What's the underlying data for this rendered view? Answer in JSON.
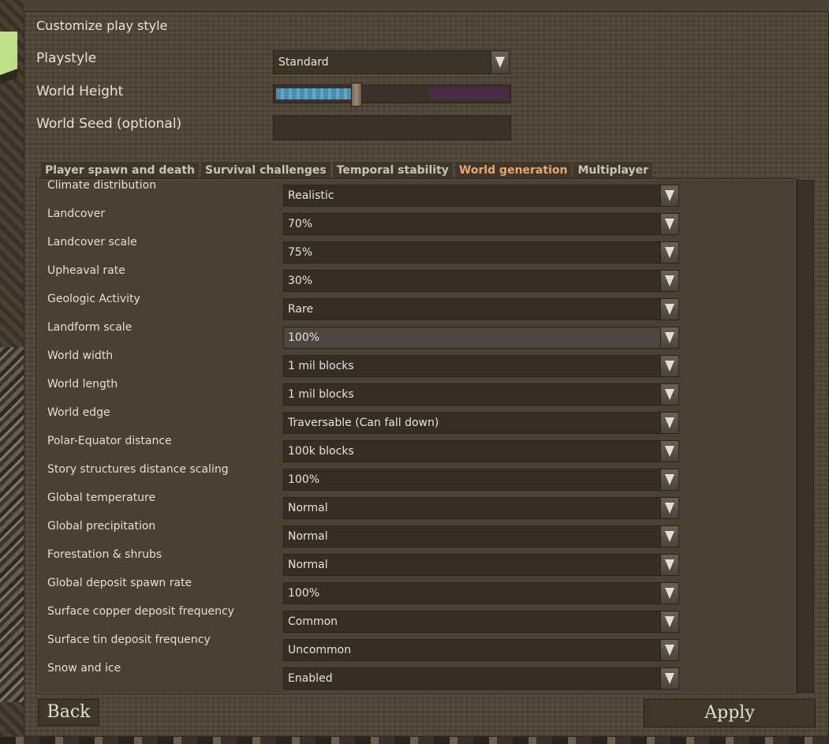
{
  "dialog": {
    "title": "Customize play style",
    "playstyle": {
      "label": "Playstyle",
      "value": "Standard"
    },
    "world_height": {
      "label": "World Height",
      "level": 0.34
    },
    "world_seed": {
      "label": "World Seed (optional)",
      "value": ""
    }
  },
  "tabs": [
    {
      "label": "Player spawn and death",
      "active": false
    },
    {
      "label": "Survival challenges",
      "active": false
    },
    {
      "label": "Temporal stability",
      "active": false
    },
    {
      "label": "World generation",
      "active": true
    },
    {
      "label": "Multiplayer",
      "active": false
    }
  ],
  "settings": [
    {
      "label": "Climate distribution",
      "value": "Realistic"
    },
    {
      "label": "Landcover",
      "value": "70%"
    },
    {
      "label": "Landcover scale",
      "value": "75%"
    },
    {
      "label": "Upheaval rate",
      "value": "30%"
    },
    {
      "label": "Geologic Activity",
      "value": "Rare"
    },
    {
      "label": "Landform scale",
      "value": "100%"
    },
    {
      "label": "World width",
      "value": "1 mil blocks"
    },
    {
      "label": "World length",
      "value": "1 mil blocks"
    },
    {
      "label": "World edge",
      "value": "Traversable (Can fall down)"
    },
    {
      "label": "Polar-Equator distance",
      "value": "100k blocks"
    },
    {
      "label": "Story structures distance scaling",
      "value": "100%"
    },
    {
      "label": "Global temperature",
      "value": "Normal"
    },
    {
      "label": "Global precipitation",
      "value": "Normal"
    },
    {
      "label": "Forestation & shrubs",
      "value": "Normal"
    },
    {
      "label": "Global deposit spawn rate",
      "value": "100%"
    },
    {
      "label": "Surface copper deposit frequency",
      "value": "Common"
    },
    {
      "label": "Surface tin deposit frequency",
      "value": "Uncommon"
    },
    {
      "label": "Snow and ice",
      "value": "Enabled"
    }
  ],
  "footer": {
    "back_label": "Back",
    "apply_label": "Apply"
  },
  "colors": {
    "active_tab": "#e9a56a",
    "panel": "#4a4033",
    "text": "#e4ded4"
  }
}
